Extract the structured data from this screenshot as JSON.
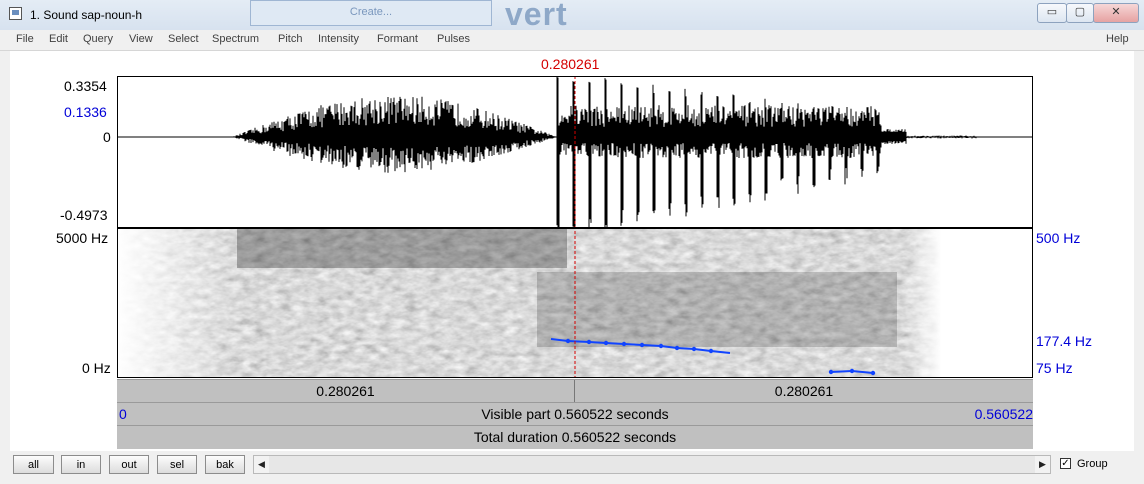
{
  "window": {
    "title": "1. Sound sap-noun-h",
    "behind_button": "Create...",
    "behind_text": "vert",
    "buttons": [
      "▭",
      "▢",
      "✕"
    ]
  },
  "menu": {
    "items": [
      "File",
      "Edit",
      "Query",
      "View",
      "Select",
      "Spectrum",
      "Pitch",
      "Intensity",
      "Formant",
      "Pulses"
    ],
    "help": "Help"
  },
  "cursor": {
    "time": "0.280261"
  },
  "waveform": {
    "max": "0.3354",
    "cursor_value": "0.1336",
    "zero": "0",
    "min": "-0.4973"
  },
  "spectrogram": {
    "top": "5000 Hz",
    "bottom": "0 Hz",
    "pitch_top": "500 Hz",
    "pitch_value": "177.4 Hz",
    "pitch_bottom": "75 Hz"
  },
  "time_bar": {
    "left": "0.280261",
    "right": "0.280261",
    "visible_start": "0",
    "visible_label": "Visible part 0.560522 seconds",
    "visible_end": "0.560522",
    "total_label": "Total duration 0.560522 seconds"
  },
  "bottom": {
    "buttons": [
      "all",
      "in",
      "out",
      "sel",
      "bak"
    ],
    "left_arrow": "◀",
    "right_arrow": "▶",
    "group_checked": "✓",
    "group_label": "Group"
  },
  "colors": {
    "cursor": "#d40000",
    "blue_text": "#0000d8",
    "pitch_line": "#1144ff"
  }
}
